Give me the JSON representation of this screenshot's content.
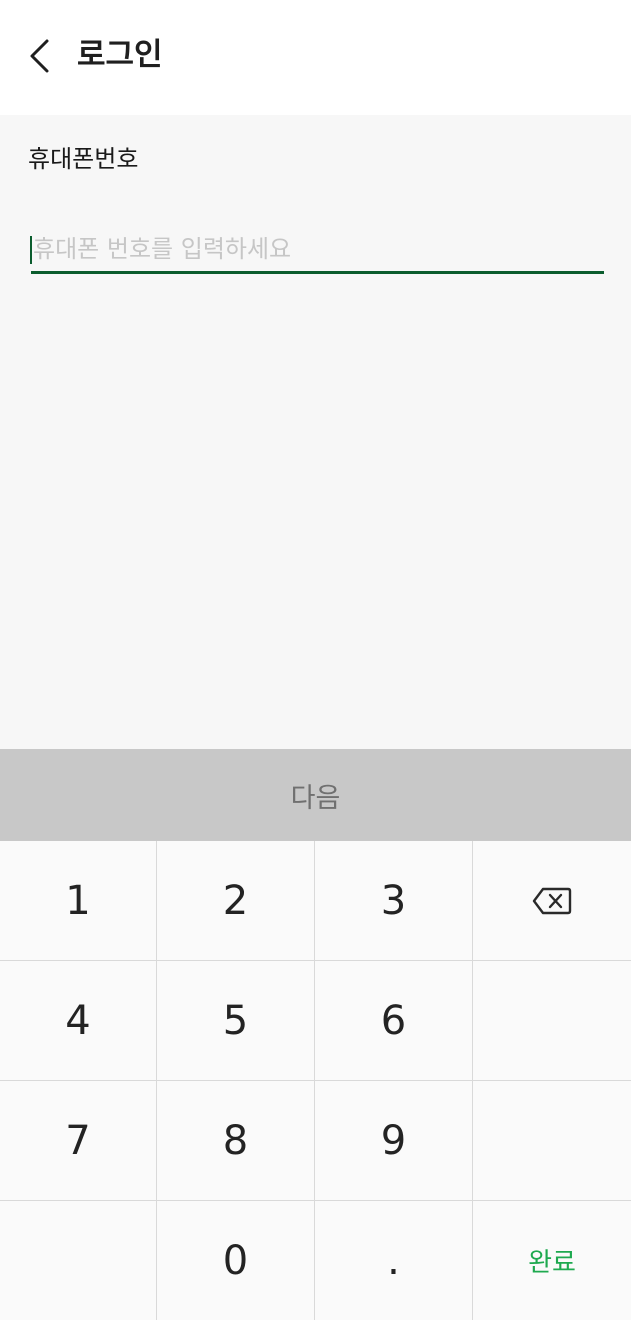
{
  "header": {
    "title": "로그인",
    "back_icon": "chevron-left-icon"
  },
  "form": {
    "phone_label": "휴대폰번호",
    "phone_value": "",
    "phone_placeholder": "휴대폰 번호를 입력하세요"
  },
  "actions": {
    "next_label": "다음"
  },
  "keypad": {
    "keys": [
      "1",
      "2",
      "3",
      "4",
      "5",
      "6",
      "7",
      "8",
      "9",
      "0",
      "."
    ],
    "backspace_icon": "backspace-icon",
    "done_label": "완료"
  },
  "colors": {
    "accent_green": "#0b5d2e",
    "done_green": "#1ea94f",
    "next_button_bg": "#c8c8c8"
  }
}
